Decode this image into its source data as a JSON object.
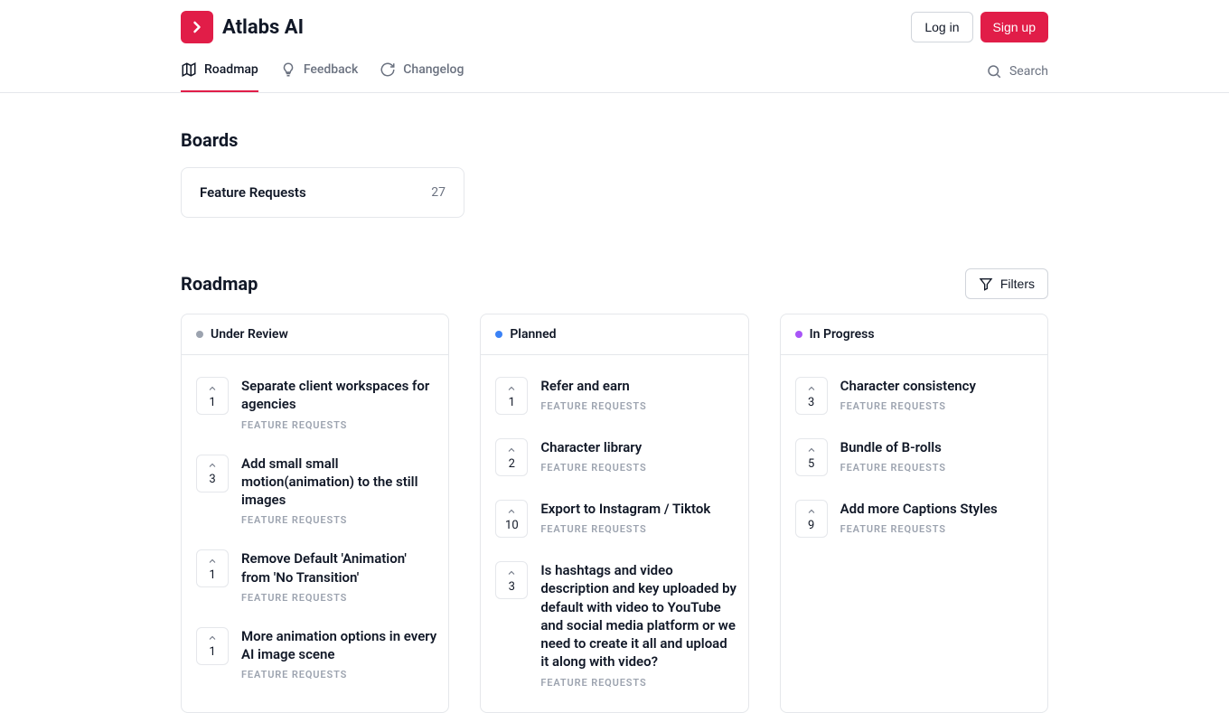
{
  "header": {
    "brand": "Atlabs AI",
    "log_in": "Log in",
    "sign_up": "Sign up"
  },
  "nav": {
    "roadmap": "Roadmap",
    "feedback": "Feedback",
    "changelog": "Changelog",
    "search": "Search"
  },
  "boards": {
    "heading": "Boards",
    "card": {
      "name": "Feature Requests",
      "count": "27"
    }
  },
  "roadmap": {
    "heading": "Roadmap",
    "filters": "Filters",
    "columns": [
      {
        "title": "Under Review",
        "dot_color": "#9ca3af",
        "items": [
          {
            "votes": "1",
            "title": "Separate client workspaces for agencies",
            "tag": "FEATURE REQUESTS"
          },
          {
            "votes": "3",
            "title": "Add small small motion(animation) to the still images",
            "tag": "FEATURE REQUESTS"
          },
          {
            "votes": "1",
            "title": "Remove Default 'Animation' from 'No Transition'",
            "tag": "FEATURE REQUESTS"
          },
          {
            "votes": "1",
            "title": "More animation options in every AI image scene",
            "tag": "FEATURE REQUESTS"
          }
        ]
      },
      {
        "title": "Planned",
        "dot_color": "#3b82f6",
        "items": [
          {
            "votes": "1",
            "title": "Refer and earn",
            "tag": "FEATURE REQUESTS"
          },
          {
            "votes": "2",
            "title": "Character library",
            "tag": "FEATURE REQUESTS"
          },
          {
            "votes": "10",
            "title": "Export to Instagram / Tiktok",
            "tag": "FEATURE REQUESTS"
          },
          {
            "votes": "3",
            "title": "Is hashtags and video description and key uploaded by default with video to YouTube and social media platform or we need to create it all and upload it along with video?",
            "tag": "FEATURE REQUESTS"
          }
        ]
      },
      {
        "title": "In Progress",
        "dot_color": "#a855f7",
        "items": [
          {
            "votes": "3",
            "title": "Character consistency",
            "tag": "FEATURE REQUESTS"
          },
          {
            "votes": "5",
            "title": "Bundle of B-rolls",
            "tag": "FEATURE REQUESTS"
          },
          {
            "votes": "9",
            "title": "Add more Captions Styles",
            "tag": "FEATURE REQUESTS"
          }
        ]
      }
    ]
  }
}
